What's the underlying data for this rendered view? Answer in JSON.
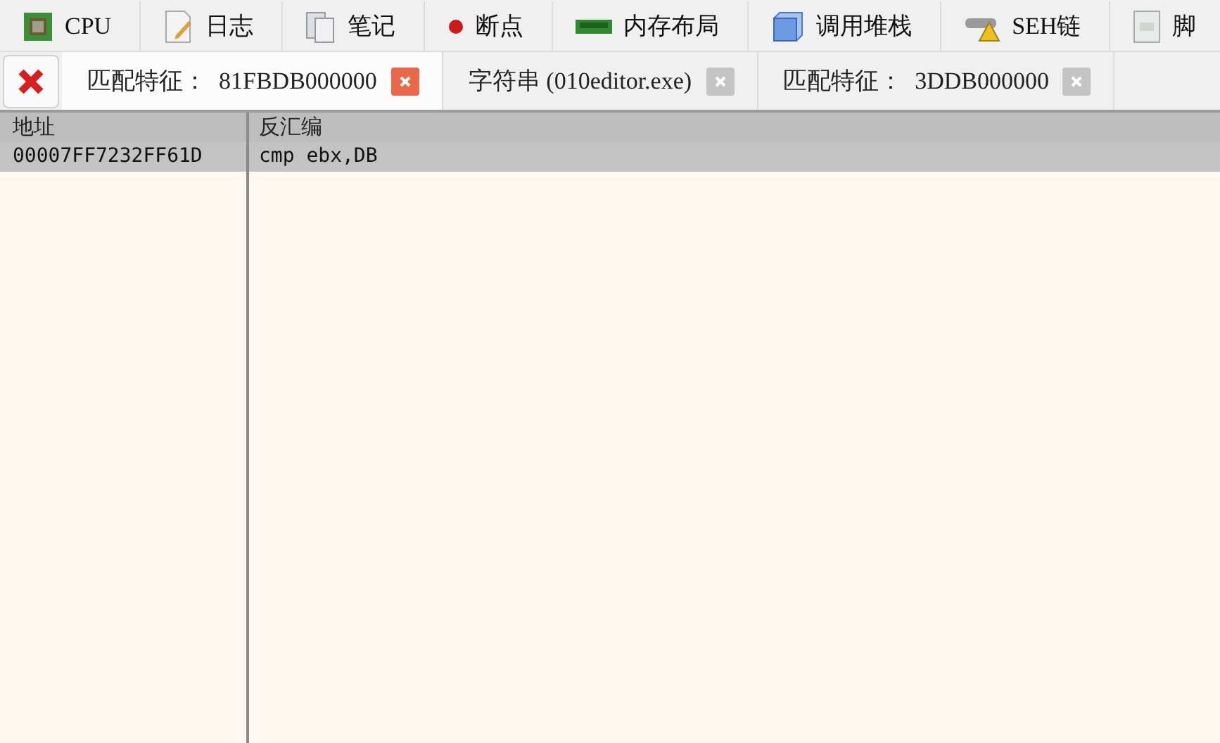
{
  "toolbar_tabs": [
    {
      "label": "CPU"
    },
    {
      "label": "日志"
    },
    {
      "label": "笔记"
    },
    {
      "label": "断点"
    },
    {
      "label": "内存布局"
    },
    {
      "label": "调用堆栈"
    },
    {
      "label": "SEH链"
    },
    {
      "label": "脚"
    }
  ],
  "search_tabs": [
    {
      "label": "匹配特征：  81FBDB000000",
      "selected": true
    },
    {
      "label": "字符串 (010editor.exe)",
      "selected": false
    },
    {
      "label": "匹配特征：  3DDB000000",
      "selected": false
    }
  ],
  "table": {
    "columns": [
      "地址",
      "反汇编"
    ],
    "rows": [
      {
        "cells": [
          "00007FF7232FF61D",
          "cmp ebx,DB"
        ],
        "selected": true
      }
    ]
  }
}
